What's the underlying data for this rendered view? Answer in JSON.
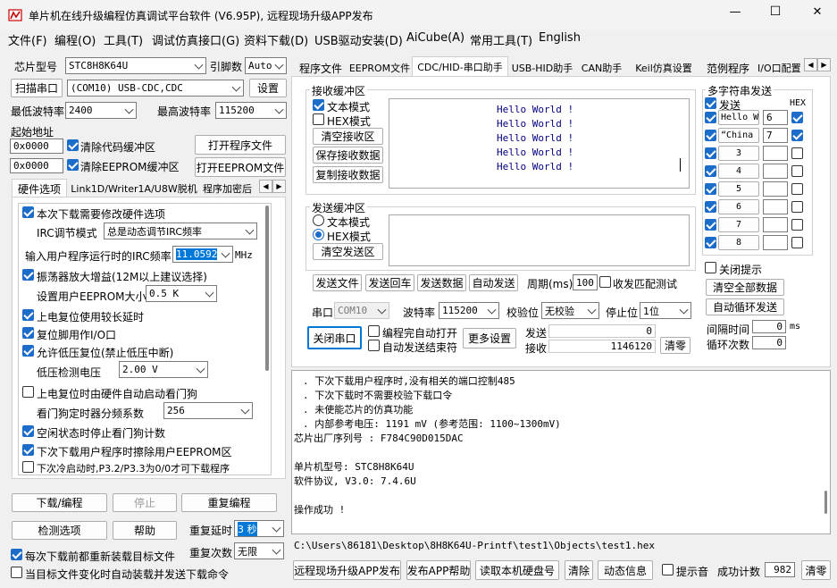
{
  "window": {
    "title": "单片机在线升级编程仿真调试平台软件 (V6.95P), 远程现场升级APP发布",
    "minimize": "—",
    "maximize": "☐",
    "close": "✕"
  },
  "menu": [
    "文件(F)",
    "编程(O)",
    "工具(T)",
    "调试仿真接口(G)",
    "资料下载(D)",
    "USB驱动安装(D)",
    "AiCube(A)",
    "常用工具(T)",
    "English"
  ],
  "left": {
    "chip_label": "芯片型号",
    "chip_value": "STC8H8K64U",
    "pin_label": "引脚数",
    "pin_value": "Auto",
    "scan_button": "扫描串口",
    "com_value": "(COM10) USB-CDC,CDC",
    "settings_button": "设置",
    "min_baud_label": "最低波特率",
    "min_baud_value": "2400",
    "max_baud_label": "最高波特率",
    "max_baud_value": "115200",
    "start_addr_label": "起始地址",
    "addr1_value": "0x0000",
    "clear_code_label": "清除代码缓冲区",
    "open_prog_button": "打开程序文件",
    "addr2_value": "0x0000",
    "clear_eeprom_label": "清除EEPROM缓冲区",
    "open_eeprom_button": "打开EEPROM文件",
    "tabs": [
      "硬件选项",
      "Link1D/Writer1A/U8W脱机",
      "程序加密后"
    ],
    "hw": {
      "modify_hw": "本次下载需要修改硬件选项",
      "irc_mode_label": "IRC调节模式",
      "irc_mode_value": "总是动态调节IRC频率",
      "irc_freq_label": "输入用户程序运行时的IRC频率",
      "irc_freq_value": "11.0592",
      "irc_freq_unit": "MHz",
      "osc_gain": "振荡器放大增益(12M以上建议选择)",
      "eeprom_size_label": "设置用户EEPROM大小",
      "eeprom_size_value": "0.5 K",
      "long_reset": "上电复位使用较长延时",
      "reset_pin": "复位脚用作I/O口",
      "lvr": "允许低压复位(禁止低压中断)",
      "lvd_label": "低压检测电压",
      "lvd_value": "2.00 V",
      "wdt_auto": "上电复位时由硬件自动启动看门狗",
      "wdt_div_label": "看门狗定时器分频系数",
      "wdt_div_value": "256",
      "idle_wdt": "空闲状态时停止看门狗计数",
      "erase_eeprom": "下次下载用户程序时擦除用户EEPROM区",
      "cold_start": "下次冷启动时,P3.2/P3.3为0/0才可下载程序"
    },
    "download_button": "下载/编程",
    "stop_button": "停止",
    "reprogram_button": "重复编程",
    "detect_button": "检测选项",
    "help_button": "帮助",
    "repeat_delay_label": "重复延时",
    "repeat_delay_value": "3 秒",
    "repeat_count_label": "重复次数",
    "repeat_count_value": "无限",
    "reload_each": "每次下载前都重新装载目标文件",
    "auto_reload": "当目标文件变化时自动装载并发送下载命令"
  },
  "right_tabs": [
    "程序文件",
    "EEPROM文件",
    "CDC/HID-串口助手",
    "USB-HID助手",
    "CAN助手",
    "Keil仿真设置",
    "范例程序",
    "I/O口配置"
  ],
  "serial": {
    "recv_group": "接收缓冲区",
    "recv_text_mode": "文本模式",
    "recv_hex_mode": "HEX模式",
    "clear_recv": "清空接收区",
    "save_recv": "保存接收数据",
    "copy_recv": "复制接收数据",
    "recv_lines": [
      "Hello World !",
      "Hello World !",
      "Hello World !",
      "Hello World !",
      "Hello World !"
    ],
    "send_group": "发送缓冲区",
    "send_text_mode": "文本模式",
    "send_hex_mode": "HEX模式",
    "clear_send": "清空发送区",
    "send_file": "发送文件",
    "send_enter": "发送回车",
    "send_data": "发送数据",
    "auto_send": "自动发送",
    "period_label": "周期(ms)",
    "period_value": "100",
    "match_test": "收发匹配测试",
    "port_label": "串口",
    "port_value": "COM10",
    "baud_label": "波特率",
    "baud_value": "115200",
    "parity_label": "校验位",
    "parity_value": "无校验",
    "stop_label": "停止位",
    "stop_value": "1位",
    "close_port": "关闭串口",
    "auto_open": "编程完自动打开",
    "auto_end": "自动发送结束符",
    "more_settings": "更多设置",
    "send_count_label": "发送",
    "send_count": "0",
    "recv_count_label": "接收",
    "recv_count": "1146120",
    "clear_count": "清零"
  },
  "multi": {
    "title": "多字符串发送",
    "send_col": "发送",
    "hex_col": "HEX",
    "rows": [
      {
        "label": "Hello W",
        "value": "6"
      },
      {
        "label": "“China",
        "value": "7"
      },
      {
        "label": "3",
        "value": ""
      },
      {
        "label": "4",
        "value": ""
      },
      {
        "label": "5",
        "value": ""
      },
      {
        "label": "6",
        "value": ""
      },
      {
        "label": "7",
        "value": ""
      },
      {
        "label": "8",
        "value": ""
      }
    ],
    "close_hint": "关闭提示",
    "clear_all": "清空全部数据",
    "auto_loop": "自动循环发送",
    "interval_label": "间隔时间",
    "interval_value": "0",
    "interval_unit": "ms",
    "loop_label": "循环次数",
    "loop_value": "0"
  },
  "log": {
    "lines": [
      ". 下次下载用户程序时,没有相关的端口控制485",
      ". 下次下载时不需要校验下载口令",
      ". 未使能芯片的仿真功能",
      ". 内部参考电压: 1191 mV (参考范围: 1100~1300mV)",
      "芯片出厂序列号 : F784C90D015DAC",
      "",
      "  单片机型号: STC8H8K64U",
      "  软件协议, V3.0: 7.4.6U",
      "",
      "操作成功 !"
    ],
    "path": "C:\\Users\\86181\\Desktop\\8H8K64U-Printf\\test1\\Objects\\test1.hex"
  },
  "bottom": {
    "publish_app": "远程现场升级APP发布",
    "publish_help": "发布APP帮助",
    "read_disk": "读取本机硬盘号",
    "clear": "清除",
    "dynamic_info": "动态信息",
    "beep": "提示音",
    "success_label": "成功计数",
    "success_count": "982",
    "clear_count": "清零"
  }
}
